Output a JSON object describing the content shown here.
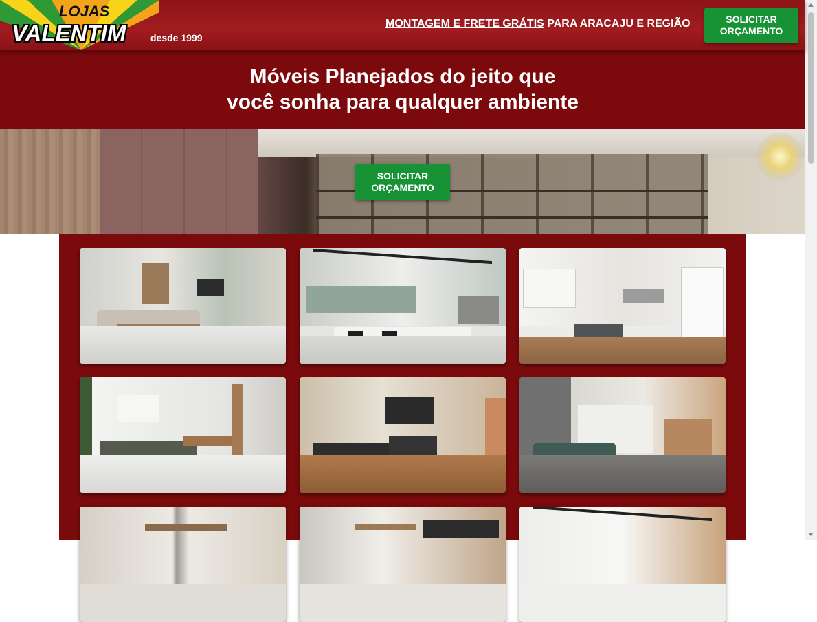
{
  "header": {
    "logo_top": "LOJAS",
    "logo_name": "VALENTIM",
    "logo_since": "desde 1999",
    "promo_underlined": "MONTAGEM E FRETE GRÁTIS",
    "promo_rest": " PARA ARACAJU E REGIÃO",
    "cta_label": "SOLICITAR ORÇAMENTO"
  },
  "headline": {
    "line1": "Móveis Planejados do jeito que",
    "line2": "você sonha para qualquer ambiente"
  },
  "hero": {
    "cta_label": "SOLICITAR ORÇAMENTO"
  },
  "gallery": {
    "items": [
      {
        "name": "living-room-photo"
      },
      {
        "name": "office-photo"
      },
      {
        "name": "white-kitchen-photo"
      },
      {
        "name": "green-kitchen-photo"
      },
      {
        "name": "dark-kitchen-photo"
      },
      {
        "name": "bedroom-photo"
      },
      {
        "name": "room-photo-7"
      },
      {
        "name": "room-photo-8"
      },
      {
        "name": "room-photo-9"
      }
    ]
  },
  "colors": {
    "header_red": "#a01c1f",
    "band_red": "#7c0a0d",
    "cta_green": "#179336"
  }
}
